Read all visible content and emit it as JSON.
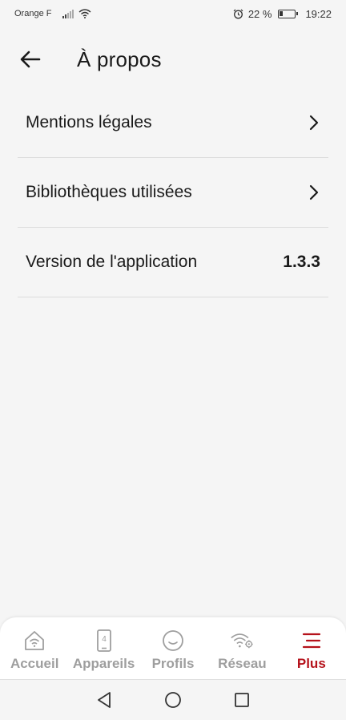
{
  "status": {
    "carrier": "Orange F",
    "battery_pct": "22 %",
    "time": "19:22"
  },
  "header": {
    "title": "À propos"
  },
  "list": {
    "items": [
      {
        "label": "Mentions légales",
        "trailing": "chevron-right-icon"
      },
      {
        "label": "Bibliothèques utilisées",
        "trailing": "chevron-right-icon"
      },
      {
        "label": "Version de l'application",
        "value": "1.3.3"
      }
    ]
  },
  "bottom_nav": {
    "items": [
      {
        "label": "Accueil",
        "icon": "home-wifi-icon",
        "active": false
      },
      {
        "label": "Appareils",
        "icon": "device-icon",
        "badge": "4",
        "active": false
      },
      {
        "label": "Profils",
        "icon": "profile-smile-icon",
        "active": false
      },
      {
        "label": "Réseau",
        "icon": "wifi-settings-icon",
        "active": false
      },
      {
        "label": "Plus",
        "icon": "menu-icon",
        "active": true
      }
    ]
  },
  "colors": {
    "accent": "#b5121b",
    "inactive": "#9e9e9e",
    "background": "#f5f5f5"
  }
}
